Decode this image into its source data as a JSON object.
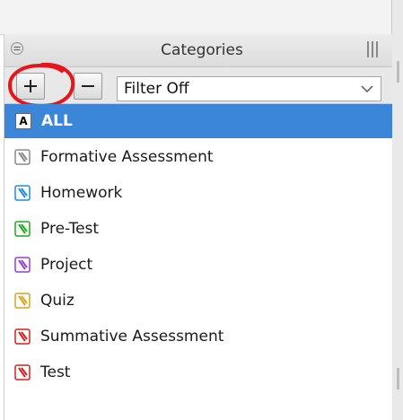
{
  "panel": {
    "title": "Categories"
  },
  "toolbar": {
    "add_label": "+",
    "remove_label": "−",
    "filter_value": "Filter Off"
  },
  "categories": [
    {
      "label": "ALL",
      "selected": true,
      "icon": "all-icon"
    },
    {
      "label": "Formative Assessment",
      "color": "#8a8a8a",
      "icon": "gray-tag-icon"
    },
    {
      "label": "Homework",
      "color": "#1a8fd8",
      "icon": "blue-tag-icon"
    },
    {
      "label": "Pre-Test",
      "color": "#1ea81e",
      "icon": "green-tag-icon"
    },
    {
      "label": "Project",
      "color": "#9a3fc7",
      "icon": "purple-tag-icon"
    },
    {
      "label": "Quiz",
      "color": "#d9a21b",
      "icon": "yellow-tag-icon"
    },
    {
      "label": "Summative Assessment",
      "color": "#d42020",
      "icon": "red-tag-icon"
    },
    {
      "label": "Test",
      "color": "#d42020",
      "icon": "red-tag-icon"
    }
  ],
  "colors": {
    "selection": "#3b86d8",
    "annotation": "#e8141b"
  }
}
